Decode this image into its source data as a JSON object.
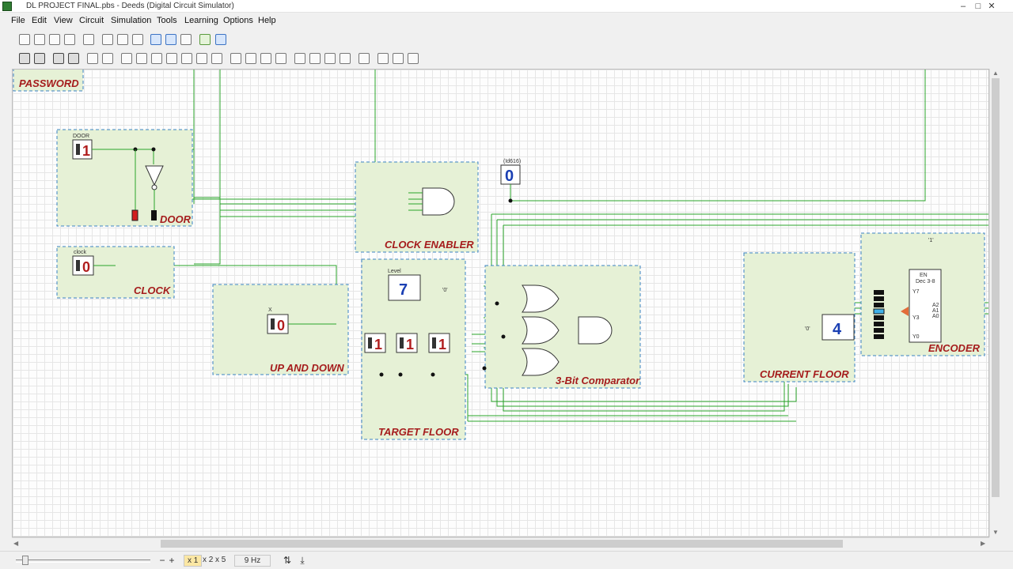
{
  "window": {
    "title": "DL PROJECT FINAL.pbs - Deeds (Digital Circuit Simulator)",
    "controls": [
      "–",
      "□",
      "✕"
    ]
  },
  "menu": [
    "File",
    "Edit",
    "View",
    "Circuit",
    "Simulation",
    "Tools",
    "Learning",
    "Options",
    "Help"
  ],
  "toolbar1": [
    "new",
    "open",
    "save",
    "print",
    "undo",
    "cut",
    "copy",
    "paste",
    "zoom-in",
    "zoom-out",
    "pan",
    "run",
    "stop"
  ],
  "toolbar2": [
    "input",
    "output",
    "clock",
    "switch",
    "ground",
    "vcc",
    "buffer",
    "not",
    "and",
    "nand",
    "or",
    "nor",
    "xor",
    "xnor",
    "flip-flop-d",
    "flip-flop-jk",
    "flip-flop-t",
    "mux",
    "counter",
    "register",
    "decoder",
    "display",
    "label",
    "probe",
    "led"
  ],
  "circuit": {
    "blocks": {
      "password": "PASSWORD",
      "door": "DOOR",
      "clock": "CLOCK",
      "clock_enabler": "CLOCK ENABLER",
      "up_and_down": "UP AND DOWN",
      "target_floor": "TARGET FLOOR",
      "comparator": "3-Bit Comparator",
      "current_floor": "CURRENT FLOOR",
      "encoder": "ENCODER"
    },
    "switch_labels": {
      "door": "DOOR",
      "clock": "clock",
      "updown": "X",
      "target_level": "Level",
      "probe": "(Id616)"
    },
    "values": {
      "door_switch": "1",
      "clock_switch": "0",
      "updown_switch": "0",
      "probe_output": "0",
      "target_display": "7",
      "target_bits": [
        "1",
        "1",
        "1"
      ],
      "current_display": "4",
      "const_zero": "'0'",
      "const_one": "'1'"
    },
    "encoder": {
      "en": "EN",
      "name": "Dec 3-8",
      "y7": "Y7",
      "y3": "Y3",
      "y0": "Y0",
      "a2": "A2",
      "a1": "A1",
      "a0": "A0"
    }
  },
  "status": {
    "zoom_minus": "−",
    "zoom_plus": "+",
    "scale_x1": "x 1",
    "scale_x2": "x 2",
    "scale_x5": "x 5",
    "frequency": "9 Hz"
  },
  "colors": {
    "block_fill": "#e6f1d6",
    "block_border": "#3b82c4",
    "label": "#a51c1c",
    "wire": "#2aa52a",
    "display_blue": "#1a3fb3"
  }
}
